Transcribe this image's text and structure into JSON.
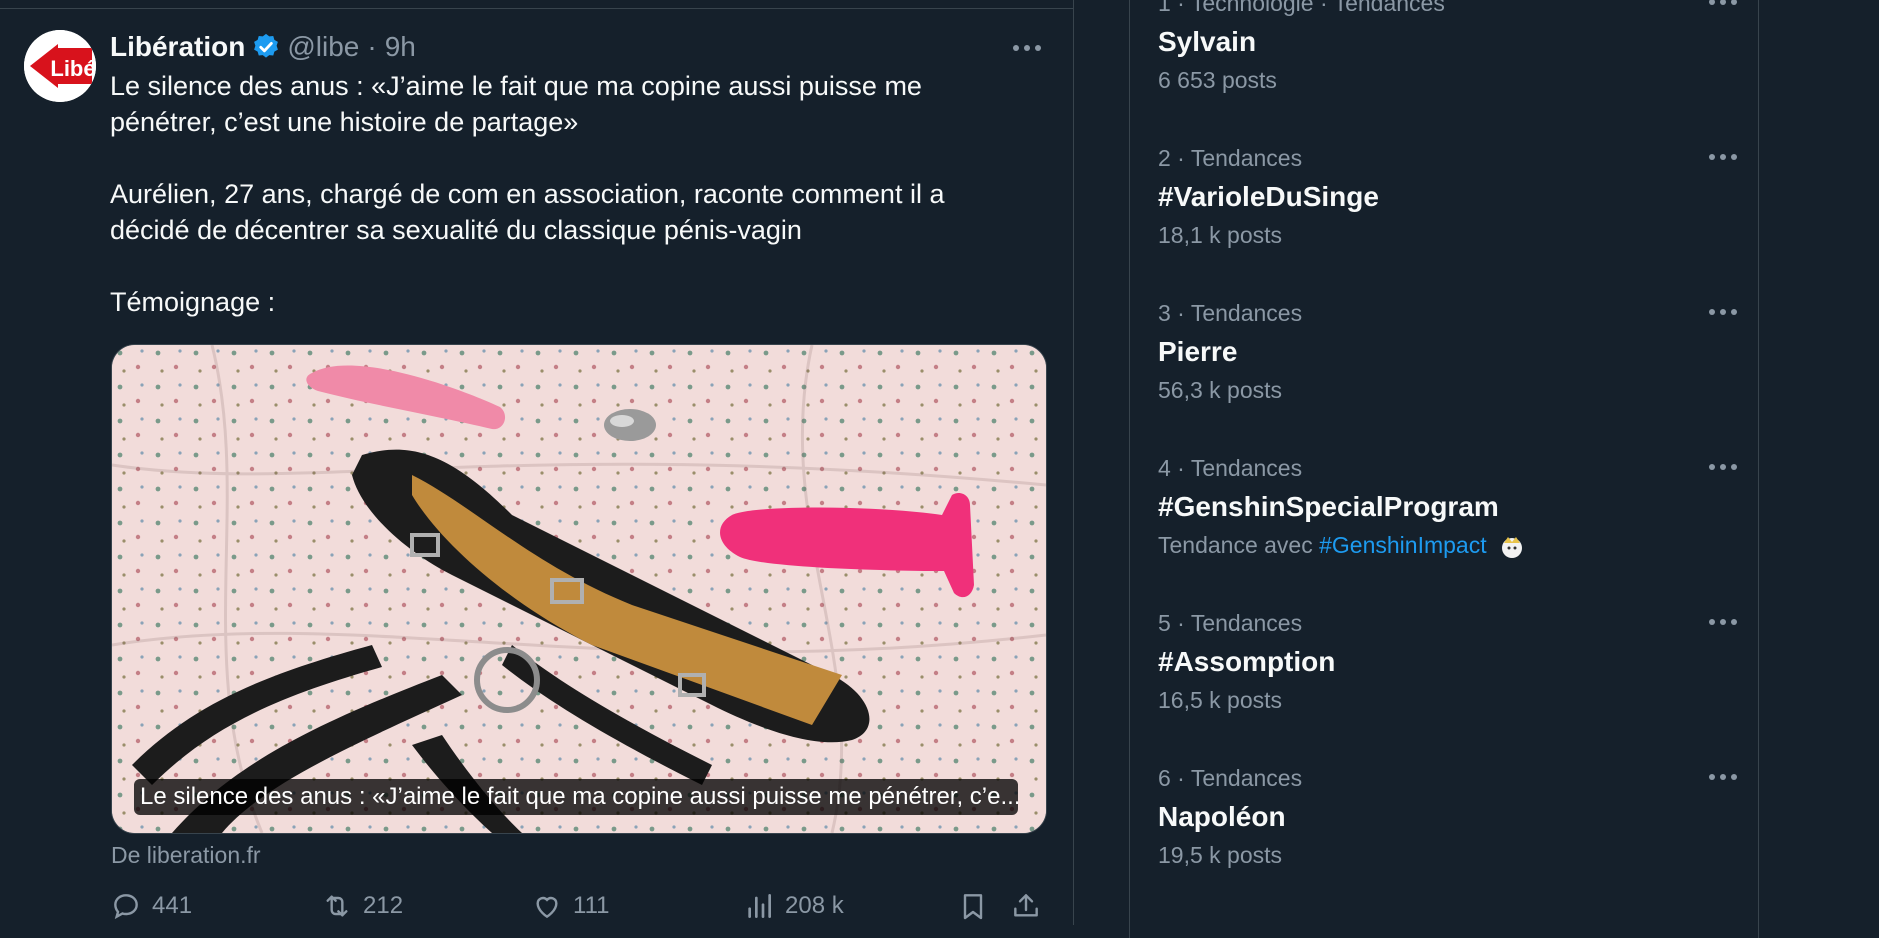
{
  "tweet": {
    "author_name": "Libération",
    "handle": "@libe",
    "separator": "·",
    "time": "9h",
    "avatar_text": "Libé",
    "text": "Le silence des anus : «J’aime le fait que ma copine aussi puisse me pénétrer, c’est une histoire de partage»\n\nAurélien, 27 ans, chargé de com en association, raconte comment il a décidé de décentrer sa sexualité du classique pénis-vagin\n\nTémoignage :",
    "media_caption": "Le silence des anus : «J’aime le fait que ma copine aussi puisse me pénétrer, c’e...",
    "source": "De liberation.fr",
    "replies": "441",
    "retweets": "212",
    "likes": "111",
    "views": "208 k"
  },
  "trends": [
    {
      "meta": "1 · Technologie · Tendances",
      "name": "Sylvain",
      "count": "6 653 posts"
    },
    {
      "meta": "2 · Tendances",
      "name": "#VarioleDuSinge",
      "count": "18,1 k posts"
    },
    {
      "meta": "3 · Tendances",
      "name": "Pierre",
      "count": "56,3 k posts"
    },
    {
      "meta": "4 · Tendances",
      "name": "#GenshinSpecialProgram",
      "with_label": "Tendance avec",
      "with_tag": "#GenshinImpact"
    },
    {
      "meta": "5 · Tendances",
      "name": "#Assomption",
      "count": "16,5 k posts"
    },
    {
      "meta": "6 · Tendances",
      "name": "Napoléon",
      "count": "19,5 k posts"
    }
  ],
  "colors": {
    "background": "#15202b",
    "text": "#f7f9f9",
    "muted": "#8b98a5",
    "accent": "#1d9bf0",
    "border": "#38444d"
  },
  "icons": {
    "verified": "verified-badge-icon",
    "more": "more-dots-icon",
    "reply": "reply-icon",
    "retweet": "retweet-icon",
    "like": "heart-icon",
    "views": "views-chart-icon",
    "bookmark": "bookmark-icon",
    "share": "share-icon"
  }
}
